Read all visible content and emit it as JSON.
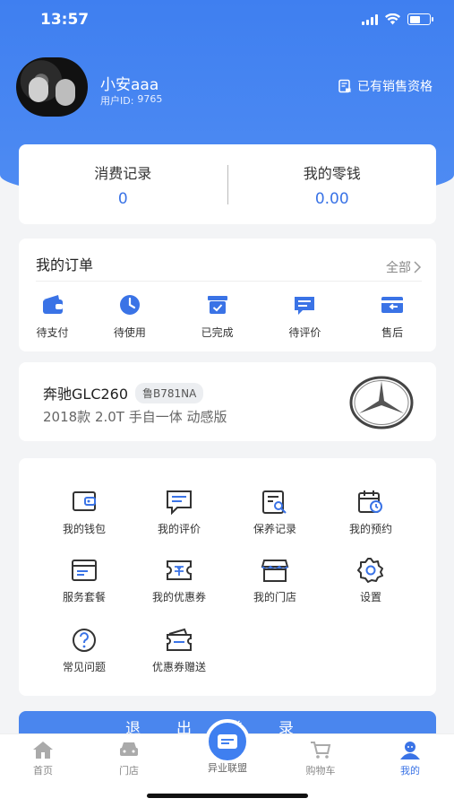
{
  "status": {
    "time": "13:57"
  },
  "profile": {
    "name": "小安aaa",
    "id_label": "用户ID:",
    "id_value": "9765",
    "sales_badge": "已有销售资格"
  },
  "stats": {
    "consumption_label": "消费记录",
    "consumption_value": "0",
    "wallet_label": "我的零钱",
    "wallet_value": "0.00"
  },
  "orders": {
    "title": "我的订单",
    "all_label": "全部",
    "items": [
      {
        "label": "待支付",
        "icon": "wallet-icon"
      },
      {
        "label": "待使用",
        "icon": "clock-icon"
      },
      {
        "label": "已完成",
        "icon": "box-check-icon"
      },
      {
        "label": "待评价",
        "icon": "comment-icon"
      },
      {
        "label": "售后",
        "icon": "return-card-icon"
      }
    ]
  },
  "car": {
    "name": "奔驰GLC260",
    "plate": "鲁B781NA",
    "desc": "2018款 2.0T 手自一体 动感版",
    "logo": "mercedes-logo"
  },
  "services": [
    {
      "label": "我的钱包",
      "icon": "wallet-icon"
    },
    {
      "label": "我的评价",
      "icon": "comment-icon"
    },
    {
      "label": "保养记录",
      "icon": "record-search-icon"
    },
    {
      "label": "我的预约",
      "icon": "calendar-clock-icon"
    },
    {
      "label": "服务套餐",
      "icon": "package-card-icon"
    },
    {
      "label": "我的优惠券",
      "icon": "coupon-icon"
    },
    {
      "label": "我的门店",
      "icon": "store-icon"
    },
    {
      "label": "设置",
      "icon": "gear-icon"
    },
    {
      "label": "常见问题",
      "icon": "question-icon"
    },
    {
      "label": "优惠券赠送",
      "icon": "coupon-gift-icon"
    }
  ],
  "logout_label": "退出登录",
  "tabs": [
    {
      "label": "首页",
      "icon": "home-icon"
    },
    {
      "label": "门店",
      "icon": "car-icon"
    },
    {
      "label": "异业联盟",
      "icon": "card-icon"
    },
    {
      "label": "购物车",
      "icon": "cart-icon"
    },
    {
      "label": "我的",
      "icon": "user-icon"
    }
  ],
  "colors": {
    "primary": "#3f7ff0",
    "value_blue": "#3a73e6",
    "background": "#f3f4f6"
  }
}
